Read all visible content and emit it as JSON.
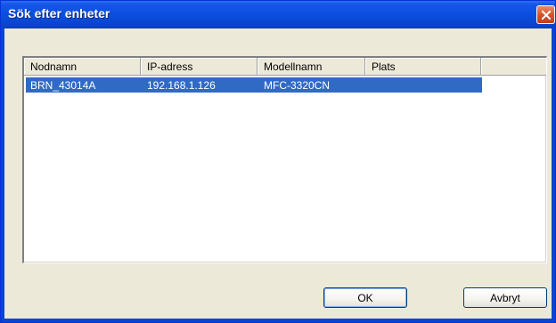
{
  "dialog": {
    "title": "Sök efter enheter",
    "close_icon": "close-icon",
    "accent_color": "#0a45d0"
  },
  "list": {
    "columns": [
      "Nodnamn",
      "IP-adress",
      "Modellnamn",
      "Plats"
    ],
    "rows": [
      {
        "node": "BRN_43014A",
        "ip": "192.168.1.126",
        "model": "MFC-3320CN",
        "location": "",
        "selected": true
      }
    ],
    "selection_color": "#316ac5"
  },
  "buttons": {
    "ok_label": "OK",
    "cancel_label": "Avbryt"
  }
}
